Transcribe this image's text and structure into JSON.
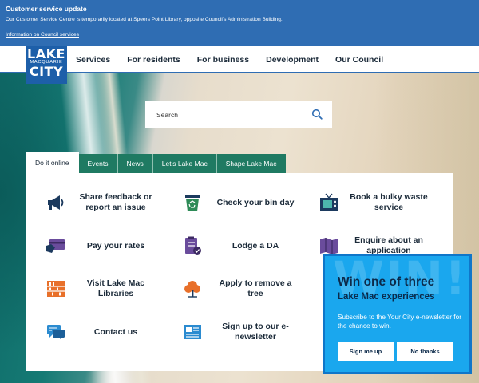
{
  "alert": {
    "title": "Customer service update",
    "text": "Our Customer Service Centre is temporarily located at Speers Point Library, opposite Council's Administration Building.",
    "link": "Information on Council services"
  },
  "logo": {
    "line1": "LAKE",
    "line2": "MACQUARIE",
    "line3": "CITY"
  },
  "nav": [
    "Services",
    "For residents",
    "For business",
    "Development",
    "Our Council"
  ],
  "search": {
    "placeholder": "Search"
  },
  "tabs": [
    {
      "label": "Do it online",
      "active": true
    },
    {
      "label": "Events",
      "active": false
    },
    {
      "label": "News",
      "active": false
    },
    {
      "label": "Let's Lake Mac",
      "active": false
    },
    {
      "label": "Shape Lake Mac",
      "active": false
    }
  ],
  "tiles": [
    {
      "label": "Share feedback or report an issue",
      "icon": "megaphone-icon"
    },
    {
      "label": "Check your bin day",
      "icon": "recycle-bin-icon"
    },
    {
      "label": "Book a bulky waste service",
      "icon": "tv-icon"
    },
    {
      "label": "Pay your rates",
      "icon": "credit-card-icon"
    },
    {
      "label": "Lodge a DA",
      "icon": "clipboard-check-icon"
    },
    {
      "label": "Enquire about an application",
      "icon": "map-icon"
    },
    {
      "label": "Visit Lake Mac Libraries",
      "icon": "books-icon"
    },
    {
      "label": "Apply to remove a tree",
      "icon": "tree-icon"
    },
    {
      "label": "Contact us",
      "icon": "chat-icon"
    },
    {
      "label": "Sign up to our e-newsletter",
      "icon": "newspaper-icon"
    }
  ],
  "popup": {
    "watermark": "WIN!",
    "title": "Win one of three",
    "subtitle": "Lake Mac experiences",
    "body": "Subscribe to the Your City e-newsletter for the chance to win.",
    "signup": "Sign me up",
    "decline": "No thanks"
  },
  "colors": {
    "brand": "#2f6db3",
    "tabs": "#1f7a62",
    "popup": "#1aa7ee"
  }
}
